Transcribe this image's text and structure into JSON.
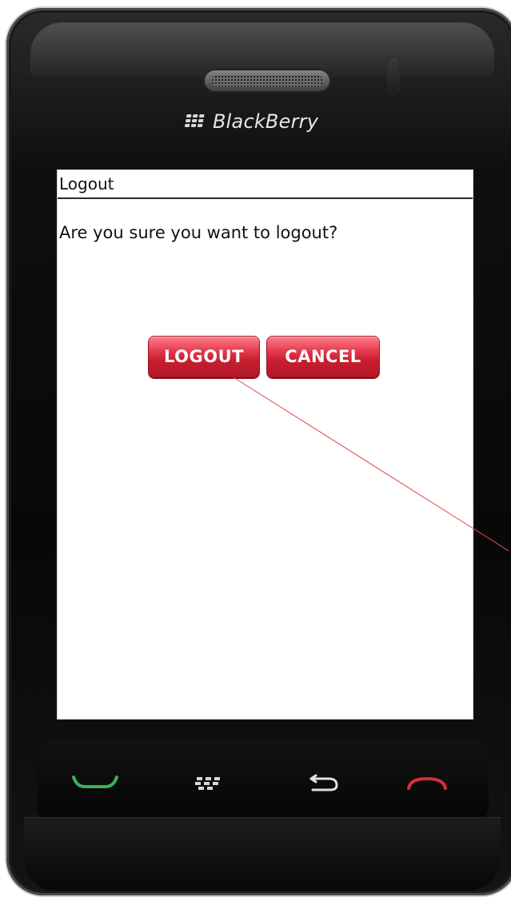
{
  "device": {
    "brand": "BlackBerry"
  },
  "screen": {
    "title": "Logout",
    "message": "Are you sure you want to logout?",
    "buttons": {
      "logout": "LOGOUT",
      "cancel": "CANCEL"
    }
  },
  "colors": {
    "button_red": "#d92f3f",
    "call_green": "#3ab05a",
    "end_red": "#d5303b",
    "annotation_line": "#e64a4a"
  },
  "icons": {
    "call": "call-icon",
    "menu": "blackberry-menu-icon",
    "back": "back-icon",
    "end": "end-call-icon"
  }
}
